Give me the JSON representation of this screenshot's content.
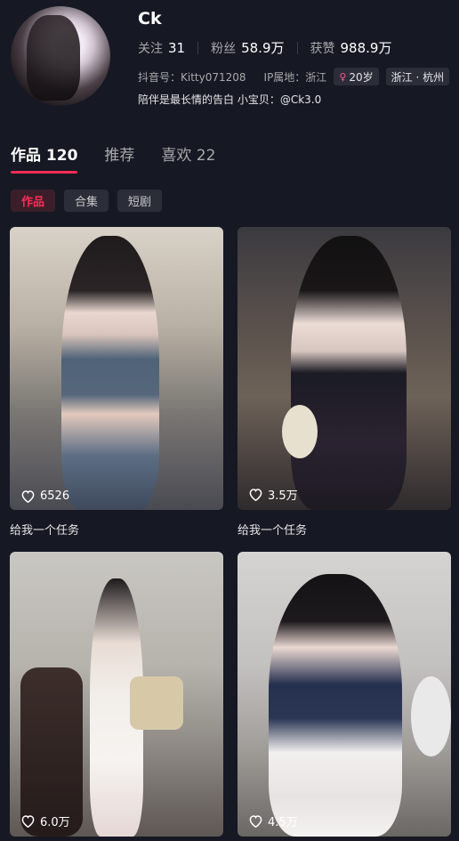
{
  "profile": {
    "name": "Ck",
    "stats": [
      {
        "label": "关注",
        "value": "31"
      },
      {
        "label": "粉丝",
        "value": "58.9万"
      },
      {
        "label": "获赞",
        "value": "988.9万"
      }
    ],
    "douyin_id": "抖音号：Kitty071208",
    "ip_location": "IP属地：浙江",
    "age_chip": "20岁",
    "age_icon": "female-icon",
    "region_chip": "浙江 · 杭州",
    "bio": "陪伴是最长情的告白 小宝贝：@Ck3.0"
  },
  "tabs": [
    {
      "label": "作品 120",
      "active": true
    },
    {
      "label": "推荐",
      "active": false
    },
    {
      "label": "喜欢 22",
      "active": false
    }
  ],
  "filters": [
    {
      "label": "作品",
      "active": true
    },
    {
      "label": "合集",
      "active": false
    },
    {
      "label": "短剧",
      "active": false
    }
  ],
  "videos": [
    {
      "likes": "6526",
      "caption": "给我一个任务"
    },
    {
      "likes": "3.5万",
      "caption": "给我一个任务"
    },
    {
      "likes": "6.0万",
      "caption": ""
    },
    {
      "likes": "4.5万",
      "caption": ""
    }
  ],
  "colors": {
    "accent": "#fe2c55",
    "background": "#161823"
  }
}
